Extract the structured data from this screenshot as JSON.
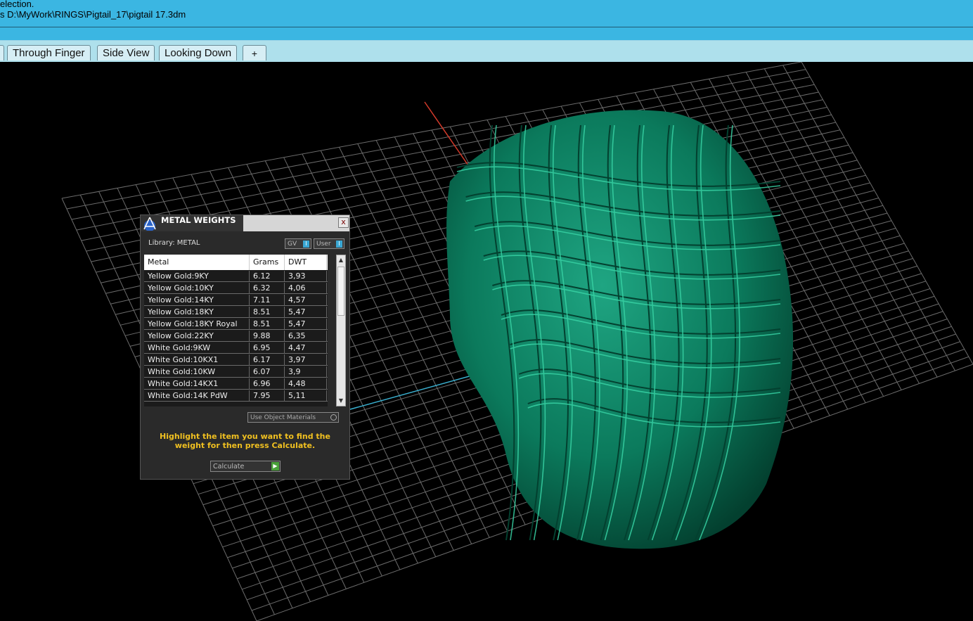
{
  "command_history": {
    "line1": "election.",
    "line2": "s D:\\MyWork\\RINGS\\Pigtail_17\\pigtail 17.3dm"
  },
  "tabs": [
    {
      "label": "Through Finger"
    },
    {
      "label": "Side View"
    },
    {
      "label": "Looking Down"
    },
    {
      "label": "+"
    }
  ],
  "colors": {
    "accent": "#3bb6e2",
    "tabbar": "#aee0ec",
    "model": "#0a8a6a",
    "hint": "#f0c020"
  },
  "dialog": {
    "title": "METAL WEIGHTS",
    "close_label": "x",
    "library_label": "Library: METAL",
    "toggle_gv": "GV",
    "toggle_user": "User",
    "toggle_knob": "I",
    "columns": [
      "Metal",
      "Grams",
      "DWT"
    ],
    "rows": [
      [
        "Yellow Gold:9KY",
        "6.12",
        "3,93"
      ],
      [
        "Yellow Gold:10KY",
        "6.32",
        "4,06"
      ],
      [
        "Yellow Gold:14KY",
        "7.11",
        "4,57"
      ],
      [
        "Yellow Gold:18KY",
        "8.51",
        "5,47"
      ],
      [
        "Yellow Gold:18KY Royal",
        "8.51",
        "5,47"
      ],
      [
        "Yellow Gold:22KY",
        "9.88",
        "6,35"
      ],
      [
        "White Gold:9KW",
        "6.95",
        "4,47"
      ],
      [
        "White Gold:10KX1",
        "6.17",
        "3,97"
      ],
      [
        "White Gold:10KW",
        "6.07",
        "3,9"
      ],
      [
        "White Gold:14KX1",
        "6.96",
        "4,48"
      ],
      [
        "White Gold:14K PdW",
        "7.95",
        "5,11"
      ]
    ],
    "use_object_materials": "Use Object Materials",
    "hint": "Highlight the item you want to find the weight for then press Calculate.",
    "calculate_label": "Calculate"
  }
}
